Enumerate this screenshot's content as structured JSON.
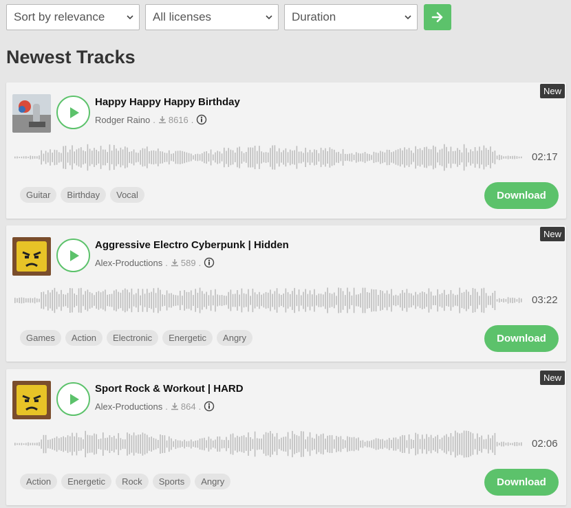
{
  "filters": {
    "sort_label": "Sort by relevance",
    "license_label": "All licenses",
    "duration_label": "Duration"
  },
  "section_title": "Newest Tracks",
  "colors": {
    "accent": "#5cc26b",
    "badge": "#3a3a3a",
    "card": "#f3f3f3",
    "page": "#e6e6e6"
  },
  "tracks": [
    {
      "badge": "New",
      "title": "Happy Happy Happy Birthday",
      "artist": "Rodger Raino",
      "downloads": "8616",
      "duration": "02:17",
      "tags": [
        "Guitar",
        "Birthday",
        "Vocal"
      ],
      "download_label": "Download"
    },
    {
      "badge": "New",
      "title": "Aggressive Electro Cyberpunk | Hidden",
      "artist": "Alex-Productions",
      "downloads": "589",
      "duration": "03:22",
      "tags": [
        "Games",
        "Action",
        "Electronic",
        "Energetic",
        "Angry"
      ],
      "download_label": "Download"
    },
    {
      "badge": "New",
      "title": "Sport Rock & Workout | HARD",
      "artist": "Alex-Productions",
      "downloads": "864",
      "duration": "02:06",
      "tags": [
        "Action",
        "Energetic",
        "Rock",
        "Sports",
        "Angry"
      ],
      "download_label": "Download"
    }
  ]
}
